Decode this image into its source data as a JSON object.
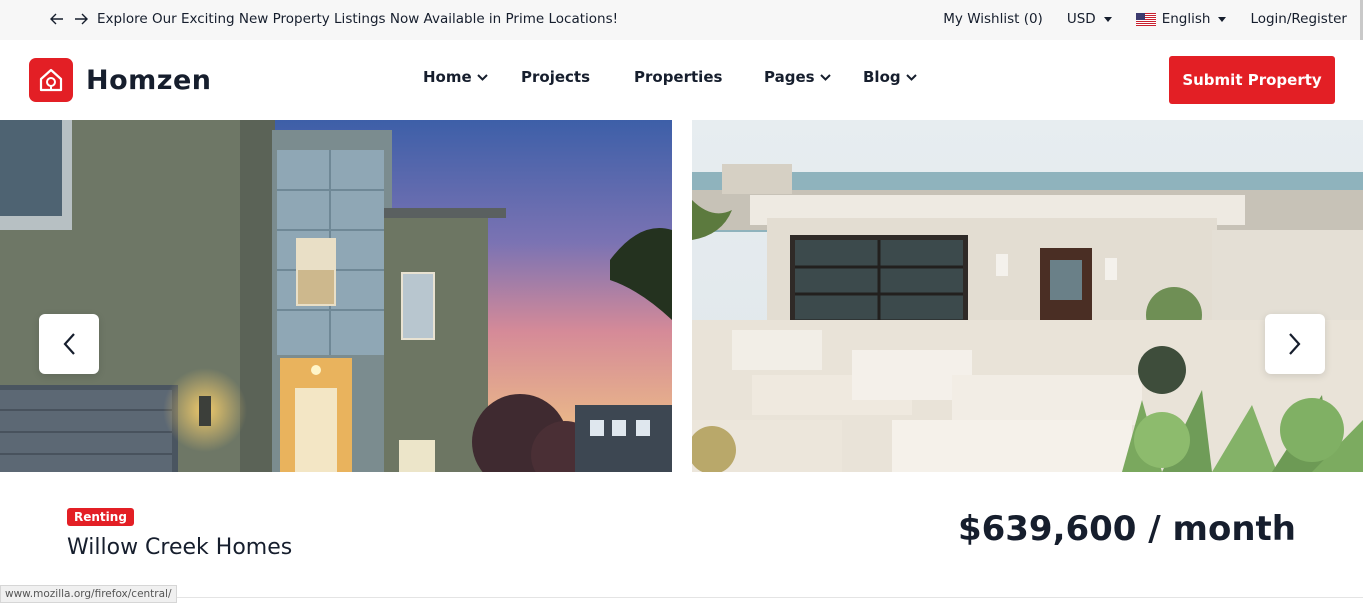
{
  "topbar": {
    "announcement": "Explore Our Exciting New Property Listings Now Available in Prime Locations!",
    "wishlist": "My Wishlist (0)",
    "currency": "USD",
    "language": "English",
    "login": "Login/Register"
  },
  "header": {
    "logo": "Homzen",
    "nav": [
      {
        "label": "Home",
        "has_dropdown": true
      },
      {
        "label": "Projects",
        "has_dropdown": false
      },
      {
        "label": "Properties",
        "has_dropdown": false
      },
      {
        "label": "Pages",
        "has_dropdown": true
      },
      {
        "label": "Blog",
        "has_dropdown": true
      }
    ],
    "submit_label": "Submit Property"
  },
  "listing": {
    "badge": "Renting",
    "title": "Willow Creek Homes",
    "price": "$639,600 / month"
  },
  "status_url": "www.mozilla.org/firefox/central/",
  "colors": {
    "accent": "#e31f25",
    "text": "#161e2d",
    "topbar_bg": "#f7f7f7"
  }
}
